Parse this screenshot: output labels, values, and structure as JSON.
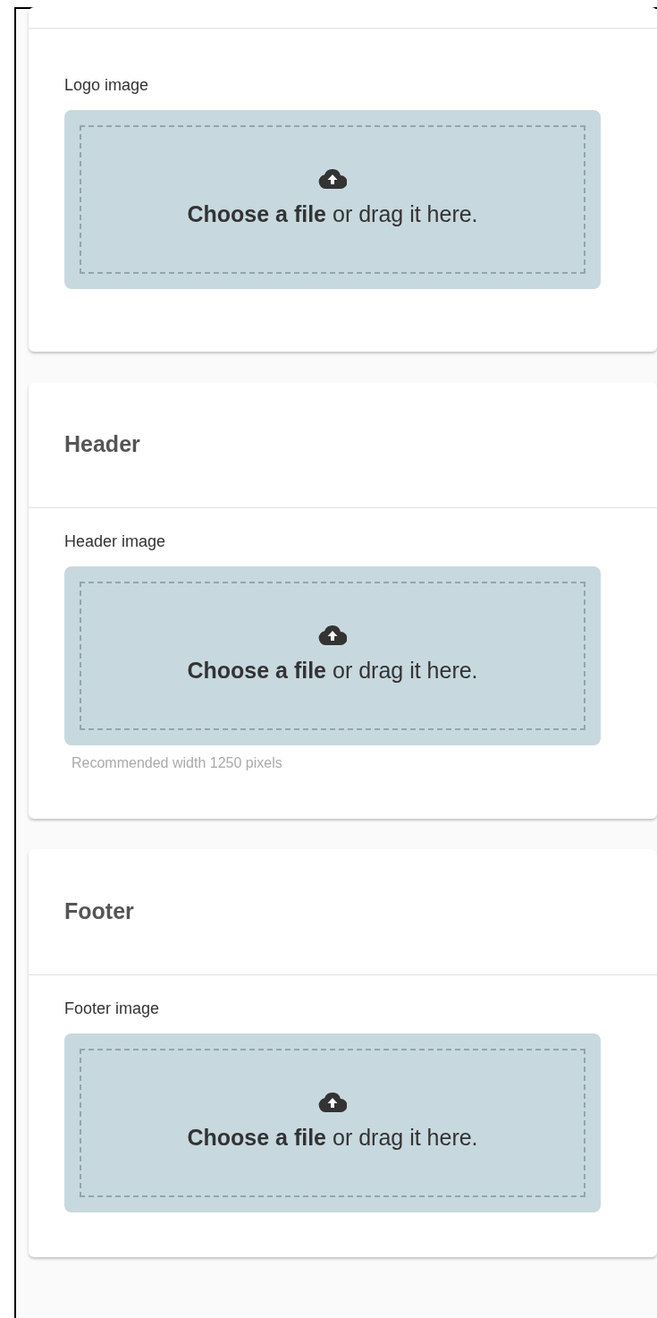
{
  "sections": [
    {
      "fields": [
        {
          "label": "Logo image",
          "dropzone": "**Choose a file** or drag it here."
        }
      ]
    },
    {
      "title": "Header",
      "fields": [
        {
          "label": "Header image",
          "dropzone": "**Choose a file** or drag it here.",
          "hint": "Recommended width 1250 pixels"
        }
      ]
    },
    {
      "title": "Footer",
      "fields": [
        {
          "label": "Footer image",
          "dropzone": "**Choose a file** or drag it here."
        }
      ]
    }
  ]
}
